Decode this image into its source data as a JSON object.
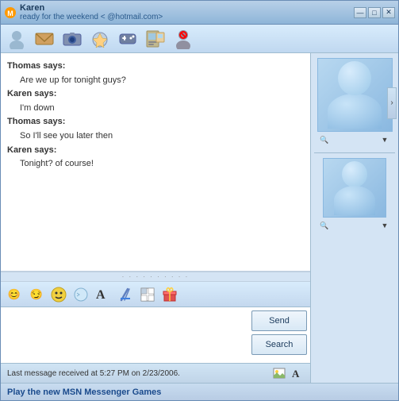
{
  "window": {
    "title": "Karen",
    "subtitle": "ready for the weekend <",
    "email": "@hotmail.com>",
    "controls": {
      "minimize": "—",
      "maximize": "□",
      "close": "✕"
    }
  },
  "toolbar": {
    "buttons": [
      {
        "name": "user-icon",
        "icon": "👤"
      },
      {
        "name": "email-icon",
        "icon": "📧"
      },
      {
        "name": "photo-icon",
        "icon": "🖼️"
      },
      {
        "name": "voice-icon",
        "icon": "🎙️"
      },
      {
        "name": "video-icon",
        "icon": "📱"
      },
      {
        "name": "share-icon",
        "icon": "🎴"
      },
      {
        "name": "block-icon",
        "icon": "🚫"
      }
    ]
  },
  "chat": {
    "messages": [
      {
        "sender": "Thomas says:",
        "text": "Are we up for tonight guys?"
      },
      {
        "sender": "Karen says:",
        "text": "I'm down"
      },
      {
        "sender": "Thomas says:",
        "text": "So I'll see you later then"
      },
      {
        "sender": "Karen says:",
        "text": "Tonight? of course!"
      }
    ]
  },
  "format_toolbar": {
    "buttons": [
      {
        "name": "emoji-btn",
        "icon": "😊"
      },
      {
        "name": "emoji2-btn",
        "icon": "😏"
      },
      {
        "name": "nudge-btn",
        "icon": "😮"
      },
      {
        "name": "wink-btn",
        "icon": "🔄"
      },
      {
        "name": "font-btn",
        "icon": "𝐀"
      },
      {
        "name": "color-btn",
        "icon": "✏️"
      },
      {
        "name": "handwriting-btn",
        "icon": "⊞"
      },
      {
        "name": "gift-btn",
        "icon": "🎁"
      }
    ]
  },
  "actions": {
    "send_label": "Send",
    "search_label": "Search"
  },
  "status_bar": {
    "message": "Last message received at 5:27 PM on 2/23/2006.",
    "icons": [
      "🖼️",
      "A"
    ]
  },
  "bottom_bar": {
    "text": "Play the new MSN Messenger Games"
  }
}
